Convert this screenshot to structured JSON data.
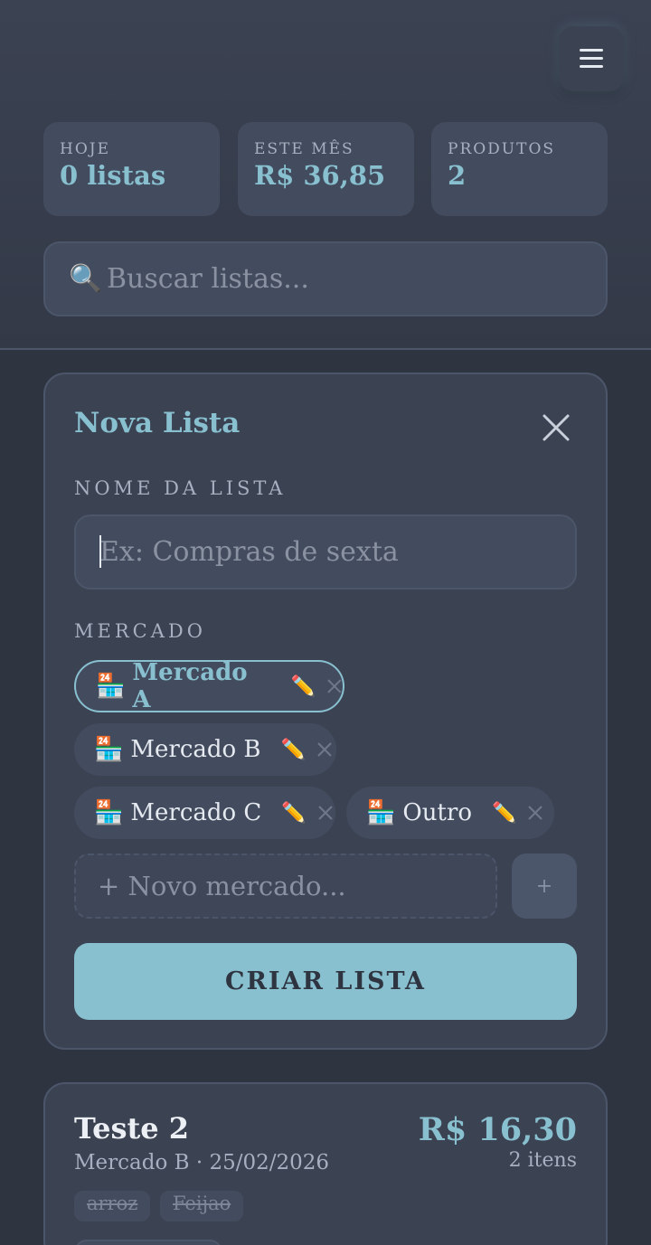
{
  "header": {
    "menu_icon": "hamburger-icon",
    "stats": [
      {
        "label": "HOJE",
        "value": "0 listas"
      },
      {
        "label": "ESTE MÊS",
        "value": "R$ 36,85"
      },
      {
        "label": "PRODUTOS",
        "value": "2"
      }
    ],
    "search": {
      "icon": "search-icon",
      "placeholder": "Buscar listas..."
    }
  },
  "new_list": {
    "title": "Nova Lista",
    "name_label": "NOME DA LISTA",
    "name_placeholder": "Ex: Compras de sexta",
    "name_value": "",
    "market_label": "MERCADO",
    "markets": [
      {
        "name": "Mercado A",
        "selected": true
      },
      {
        "name": "Mercado B",
        "selected": false
      },
      {
        "name": "Mercado C",
        "selected": false
      },
      {
        "name": "Outro",
        "selected": false
      }
    ],
    "new_market_placeholder": "+ Novo mercado...",
    "add_market_label": "+",
    "create_label": "CRIAR LISTA"
  },
  "lists": [
    {
      "title": "Teste 2",
      "subtitle": "Mercado B · 25/02/2026",
      "total": "R$ 16,30",
      "count": "2 itens",
      "items": [
        "arroz",
        "Feijao"
      ]
    }
  ],
  "colors": {
    "accent": "#88c0d0",
    "background": "#2e3440",
    "card": "#3b4252",
    "surface": "#434c5e",
    "border": "#4c566a"
  }
}
